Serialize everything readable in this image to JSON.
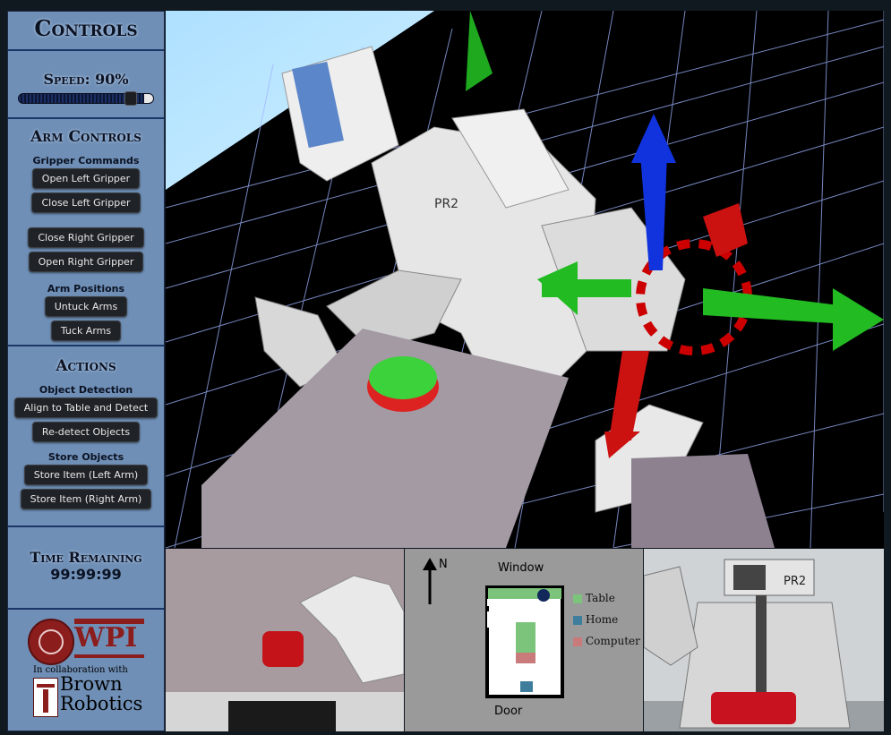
{
  "controls": {
    "title": "Controls"
  },
  "speed": {
    "label": "Speed: 90%",
    "value_percent": 90
  },
  "arm_controls": {
    "title": "Arm Controls",
    "gripper_label": "Gripper Commands",
    "open_left": "Open Left Gripper",
    "close_left": "Close Left Gripper",
    "close_right": "Close Right Gripper",
    "open_right": "Open Right Gripper",
    "positions_label": "Arm Positions",
    "untuck": "Untuck Arms",
    "tuck": "Tuck Arms"
  },
  "actions": {
    "title": "Actions",
    "detection_label": "Object Detection",
    "align_detect": "Align to Table and Detect",
    "redetect": "Re-detect Objects",
    "store_label": "Store Objects",
    "store_left": "Store Item (Left Arm)",
    "store_right": "Store Item (Right Arm)"
  },
  "time": {
    "title": "Time Remaining",
    "value": "99:99:99"
  },
  "logos": {
    "wpi": "WPI",
    "collab": "In collaboration with",
    "brown_line1": "Brown",
    "brown_line2": "Robotics"
  },
  "viewer": {
    "robot_label": "PR2"
  },
  "map": {
    "north": "N",
    "window": "Window",
    "door": "Door",
    "legend": [
      {
        "label": "Table",
        "color": "#7cc47c"
      },
      {
        "label": "Home",
        "color": "#3e7e9c"
      },
      {
        "label": "Computer",
        "color": "#c97a7a"
      }
    ]
  },
  "camera_right": {
    "robot_label": "PR2"
  },
  "colors": {
    "sidebar": "#6f8fb6",
    "button": "#1f2226",
    "grid": "#ffffff",
    "table_zone": "#7cc47c",
    "home_zone": "#3e7e9c",
    "computer_zone": "#c97a7a"
  }
}
